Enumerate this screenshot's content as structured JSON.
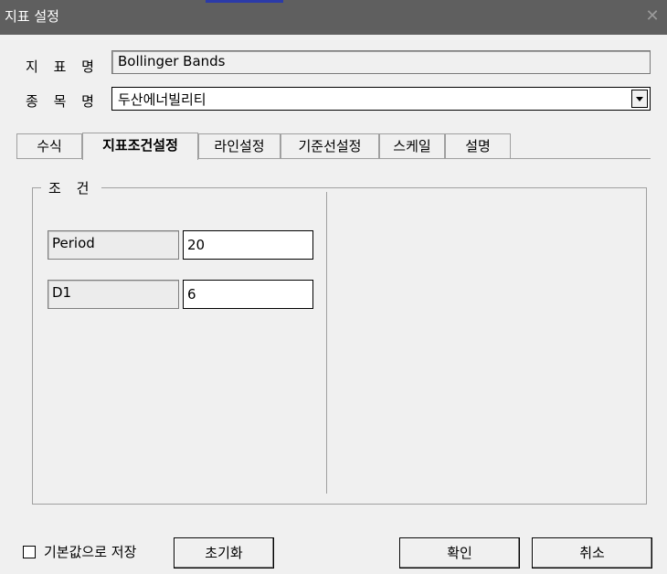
{
  "window": {
    "title": "지표 설정",
    "close_icon": "close-icon"
  },
  "form": {
    "indicator_label": "지 표 명",
    "indicator_value": "Bollinger Bands",
    "stock_label": "종 목 명",
    "stock_value": "두산에너빌리티"
  },
  "tabs": [
    {
      "label": "수식",
      "active": false
    },
    {
      "label": "지표조건설정",
      "active": true
    },
    {
      "label": "라인설정",
      "active": false
    },
    {
      "label": "기준선설정",
      "active": false
    },
    {
      "label": "스케일",
      "active": false
    },
    {
      "label": "설명",
      "active": false
    }
  ],
  "conditions": {
    "title": "조 건",
    "params": [
      {
        "label": "Period",
        "value": "20"
      },
      {
        "label": "D1",
        "value": "6"
      }
    ]
  },
  "footer": {
    "save_default_label": "기본값으로 저장",
    "save_default_checked": false,
    "reset_label": "초기화",
    "ok_label": "확인",
    "cancel_label": "취소"
  }
}
